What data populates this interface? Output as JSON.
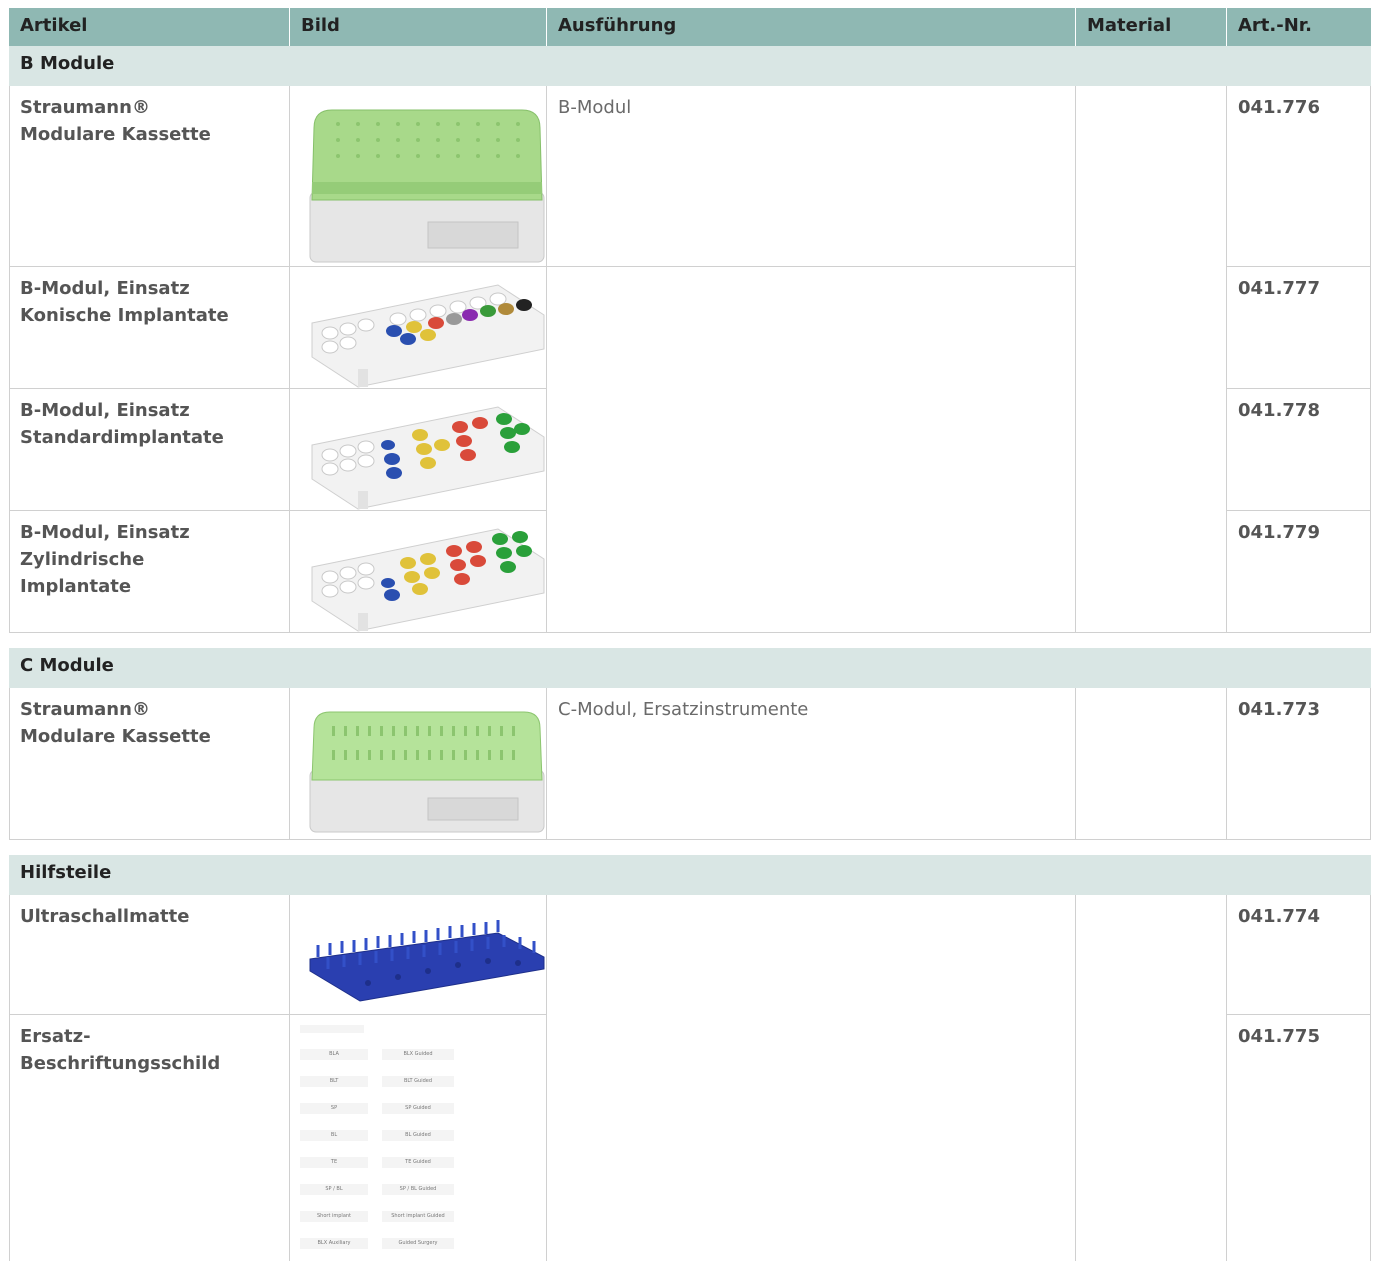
{
  "header": {
    "col_artikel": "Artikel",
    "col_bild": "Bild",
    "col_ausfuehrung": "Ausführung",
    "col_material": "Material",
    "col_artnr": "Art.-Nr."
  },
  "sections": {
    "b": {
      "title": "B Module",
      "rows": [
        {
          "artikel": "Straumann® Modulare Kassette",
          "ausfuehrung": "B-Modul",
          "artnr": "041.776"
        },
        {
          "artikel": "B-Modul, Einsatz Konische Implantate",
          "artnr": "041.777"
        },
        {
          "artikel": "B-Modul, Einsatz Standardimplantate",
          "artnr": "041.778"
        },
        {
          "artikel": "B-Modul, Einsatz Zylindrische Implantate",
          "artnr": "041.779"
        }
      ]
    },
    "c": {
      "title": "C Module",
      "rows": [
        {
          "artikel": "Straumann® Modulare Kassette",
          "ausfuehrung": "C-Modul, Ersatzinstrumente",
          "artnr": "041.773"
        }
      ]
    },
    "h": {
      "title": "Hilfsteile",
      "rows": [
        {
          "artikel": "Ultraschallmatte",
          "artnr": "041.774"
        },
        {
          "artikel": "Ersatz-Beschriftungsschild",
          "artnr": "041.775"
        }
      ]
    }
  },
  "label_sheet": {
    "left": [
      "BLA",
      "BLT",
      "SP",
      "BL",
      "TE",
      "SP / BL",
      "Short implant",
      "BLX Auxiliary"
    ],
    "right": [
      "BLX Guided",
      "BLT Guided",
      "SP Guided",
      "BL Guided",
      "TE Guided",
      "SP / BL Guided",
      "Short implant Guided",
      "Guided Surgery"
    ]
  },
  "colors": {
    "header_bg": "#8fb8b3",
    "section_bg": "#d9e6e4",
    "lid_green": "#a8d98a",
    "mat_blue": "#2a3fb0"
  }
}
